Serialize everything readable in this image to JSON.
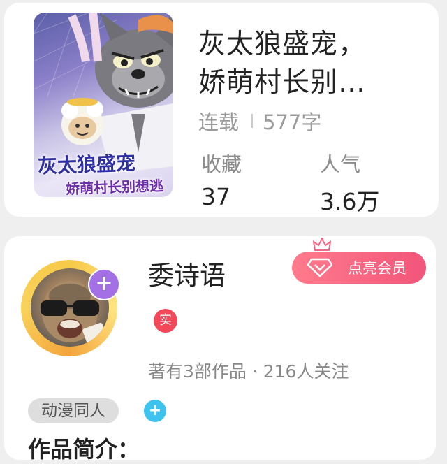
{
  "book": {
    "title_line1": "灰太狼盛宠，",
    "title_line2": "娇萌村长别…",
    "status": "连载",
    "word_count": "577字",
    "favorites_label": "收藏",
    "favorites_value": "37",
    "popularity_label": "人气",
    "popularity_value": "3.6万",
    "cover_text_line1": "灰太狼盛宠",
    "cover_text_line2": "娇萌村长别想逃"
  },
  "author": {
    "name": "委诗语",
    "vip_label": "点亮会员",
    "verified_label": "实",
    "works_text": "著有3部作品 · 216人关注",
    "tag": "动漫同人",
    "plus_symbol": "+"
  },
  "intro": {
    "heading": "作品简介："
  },
  "colors": {
    "vip_gradient": [
      "#ff7b8c",
      "#f2557a"
    ],
    "avatar_plus": "#a470e6",
    "tag_plus": "#3ec3ef",
    "verified": "#f3485a"
  },
  "icons": [
    "crown-icon",
    "diamond-icon",
    "plus-icon"
  ]
}
